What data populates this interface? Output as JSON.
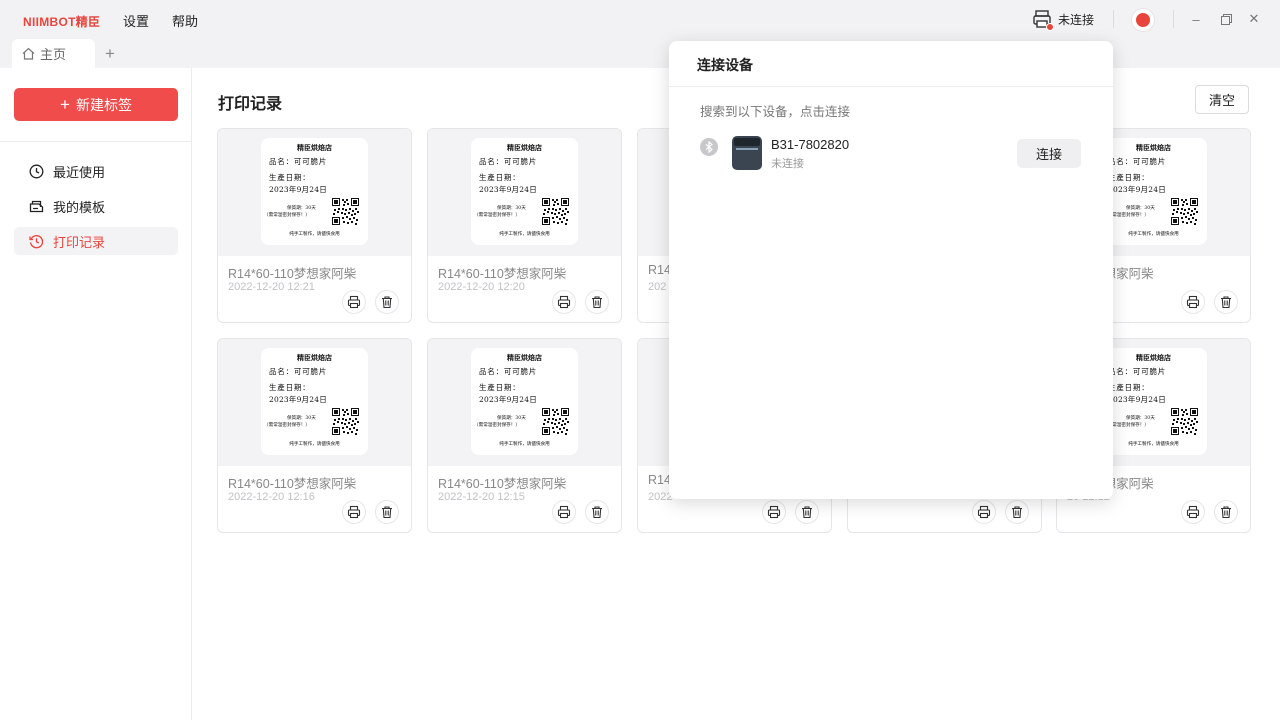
{
  "app": {
    "logo": "NIIMBOT精臣"
  },
  "menu": {
    "settings": "设置",
    "help": "帮助"
  },
  "printer": {
    "status": "未连接",
    "status_color": "#e8453c"
  },
  "tabs": {
    "home": "主页",
    "add": "+"
  },
  "sidebar": {
    "new_label": "新建标签",
    "items": [
      {
        "label": "最近使用",
        "icon": "clock-icon"
      },
      {
        "label": "我的模板",
        "icon": "template-icon"
      },
      {
        "label": "打印记录",
        "icon": "history-icon",
        "active": true
      }
    ]
  },
  "main": {
    "title": "打印记录",
    "clear_label": "清空",
    "label_content": {
      "shop": "精臣烘焙店",
      "product": "品名：可可脆片",
      "prod_date_label": "生產日期：",
      "prod_date": "2023年9月24日",
      "shelf_life": "保質期：30天",
      "storage": "（需常温密封保存！）",
      "footer": "纯手工製作，请儘快食用"
    },
    "records": [
      {
        "name": "R14*60-110梦想家阿柴",
        "date": "2022-12-20 12:21"
      },
      {
        "name": "R14*60-110梦想家阿柴",
        "date": "2022-12-20 12:20"
      },
      {
        "name": "R14",
        "date": "202"
      },
      {
        "name": "",
        "date": ""
      },
      {
        "name": "-110梦想家阿柴",
        "date": "20 12:17"
      },
      {
        "name": "R14*60-110梦想家阿柴",
        "date": "2022-12-20 12:16"
      },
      {
        "name": "R14*60-110梦想家阿柴",
        "date": "2022-12-20 12:15"
      },
      {
        "name": "R14",
        "date": "2022"
      },
      {
        "name": "",
        "date": ""
      },
      {
        "name": "-110梦想家阿柴",
        "date": "20 12:12"
      }
    ]
  },
  "popup": {
    "title": "连接设备",
    "hint": "搜索到以下设备，点击连接",
    "device": {
      "name": "B31-7802820",
      "status": "未连接"
    },
    "connect_label": "连接"
  },
  "colors": {
    "accent": "#f14c4c",
    "bg_chrome": "#f2f2f4"
  }
}
